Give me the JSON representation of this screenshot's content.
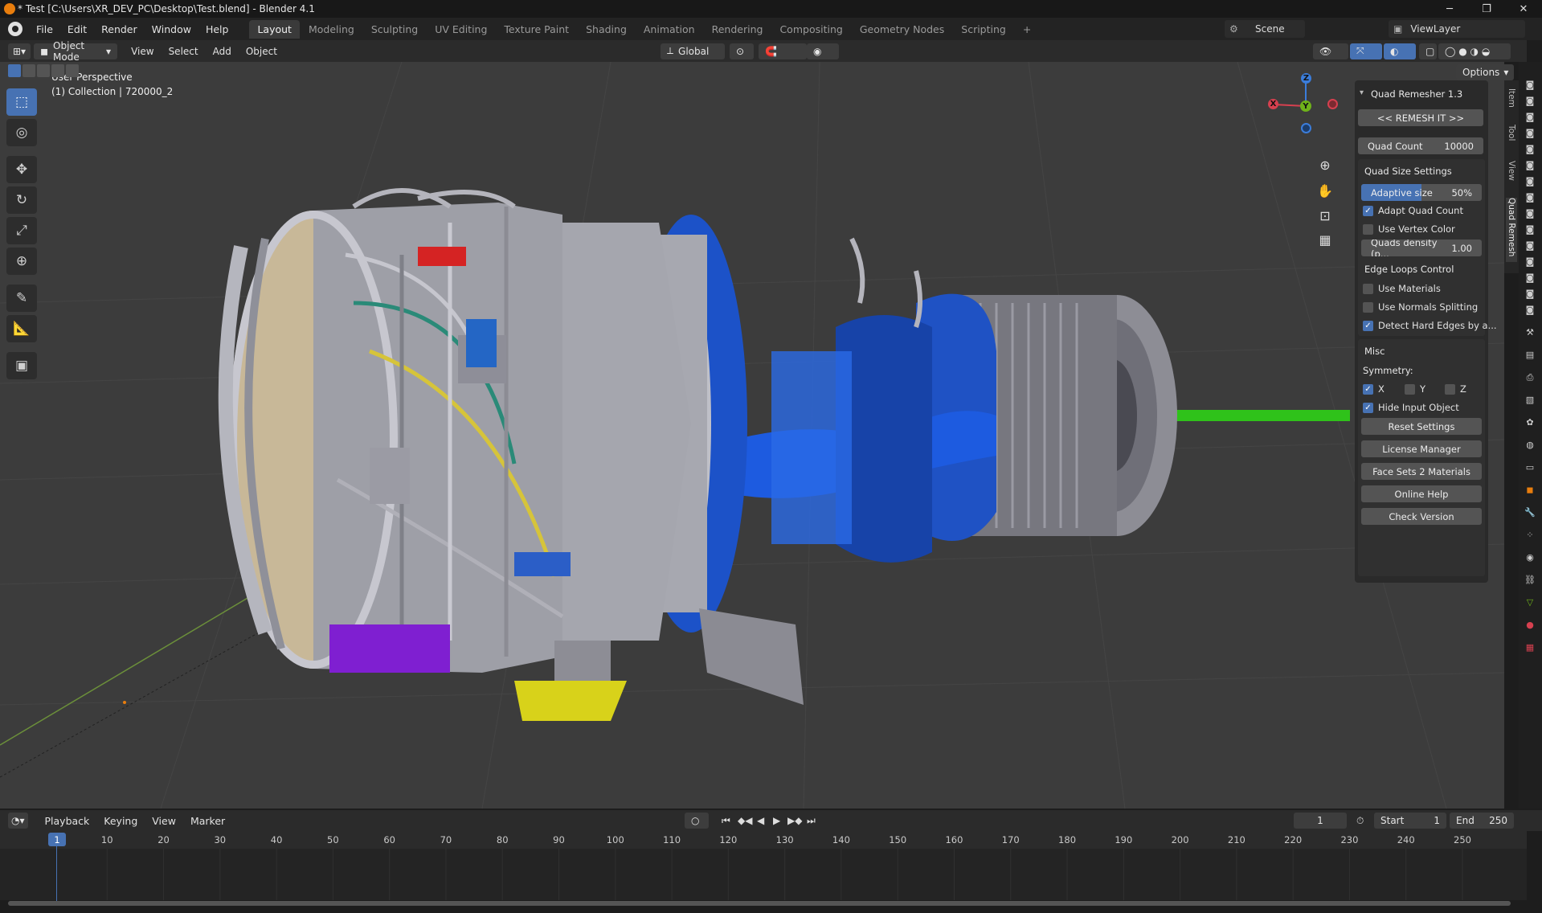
{
  "window": {
    "title": "* Test [C:\\Users\\XR_DEV_PC\\Desktop\\Test.blend] - Blender 4.1",
    "controls": [
      "─",
      "❐",
      "✕"
    ]
  },
  "menu": [
    "File",
    "Edit",
    "Render",
    "Window",
    "Help"
  ],
  "workspaces": [
    "Layout",
    "Modeling",
    "Sculpting",
    "UV Editing",
    "Texture Paint",
    "Shading",
    "Animation",
    "Rendering",
    "Compositing",
    "Geometry Nodes",
    "Scripting",
    "+"
  ],
  "scene": "Scene",
  "view_layer": "ViewLayer",
  "viewport_header": {
    "mode": "Object Mode",
    "menus": [
      "View",
      "Select",
      "Add",
      "Object"
    ],
    "orientation": "Global",
    "options": "Options"
  },
  "overlay_text": {
    "line1": "User Perspective",
    "line2": "(1) Collection | 720000_2"
  },
  "gizmo": {
    "z": "Z",
    "x": "X",
    "y": "Y"
  },
  "quad_remesher": {
    "title": "Quad Remesher 1.3",
    "remesh_button": "<< REMESH IT >>",
    "quad_count_label": "Quad Count",
    "quad_count_value": "10000",
    "size_settings": {
      "title": "Quad Size Settings",
      "adaptive_label": "Adaptive size",
      "adaptive_value": "50%",
      "adaptive_fraction": 0.5,
      "adapt_quad_count": "Adapt Quad Count",
      "use_vertex_color": "Use Vertex Color",
      "density_label": "Quads density (p...",
      "density_value": "1.00"
    },
    "edge_loops": {
      "title": "Edge Loops Control",
      "use_materials": "Use Materials",
      "use_normals": "Use Normals Splitting",
      "detect_hard": "Detect Hard Edges by a..."
    },
    "misc": {
      "title": "Misc",
      "symmetry": "Symmetry:",
      "x": "X",
      "y": "Y",
      "z": "Z",
      "hide_input": "Hide Input Object",
      "buttons": [
        "Reset Settings",
        "License Manager",
        "Face Sets 2 Materials",
        "Online Help",
        "Check Version"
      ]
    }
  },
  "side_tabs": [
    "Item",
    "Tool",
    "View",
    "Quad Remesh"
  ],
  "timeline": {
    "menus": [
      "Playback",
      "Keying",
      "View",
      "Marker"
    ],
    "current_frame": "1",
    "start_label": "Start",
    "start": "1",
    "end_label": "End",
    "end": "250",
    "ticks": [
      "10",
      "20",
      "30",
      "40",
      "50",
      "60",
      "70",
      "80",
      "90",
      "100",
      "110",
      "120",
      "130",
      "140",
      "150",
      "160",
      "170",
      "180",
      "190",
      "200",
      "210",
      "220",
      "230",
      "240",
      "250"
    ]
  },
  "colors": {
    "accent": "#4772b3",
    "viewport_bg": "#3c3c3c",
    "x_axis": "#d6404f",
    "y_axis": "#6fb21a",
    "z_axis": "#3b7ddb"
  }
}
